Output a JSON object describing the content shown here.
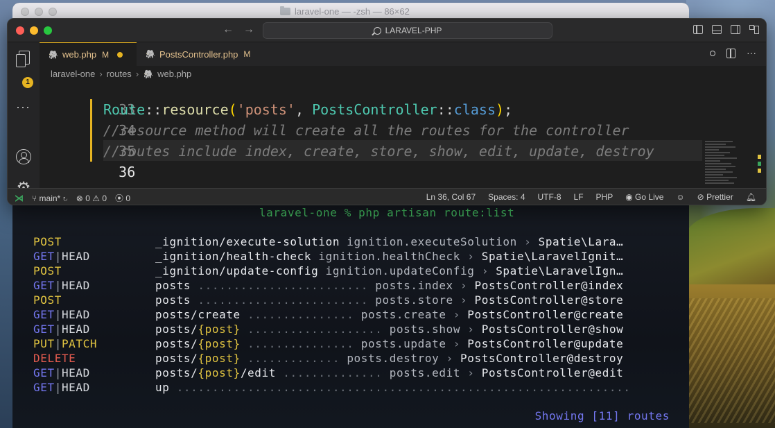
{
  "terminal": {
    "title": "laravel-one — -zsh — 86×62",
    "prompt": "laravel-one % php artisan route:list",
    "routes": [
      {
        "m1": "POST",
        "m2": "",
        "uri": "_ignition/execute-solution",
        "param": "",
        "uri_rest": "",
        "dots": "",
        "name": "ignition.executeSolution",
        "action": "Spatie\\Lara…",
        "m1_class": "m-post"
      },
      {
        "m1": "GET",
        "m2": "HEAD",
        "uri": "_ignition/health-check",
        "param": "",
        "uri_rest": "",
        "dots": "",
        "name": "ignition.healthCheck",
        "action": "Spatie\\LaravelIgnit…",
        "m1_class": "m-get"
      },
      {
        "m1": "POST",
        "m2": "",
        "uri": "_ignition/update-config",
        "param": "",
        "uri_rest": "",
        "dots": "",
        "name": "ignition.updateConfig",
        "action": "Spatie\\LaravelIgn…",
        "m1_class": "m-post"
      },
      {
        "m1": "GET",
        "m2": "HEAD",
        "uri": "posts",
        "param": "",
        "uri_rest": "",
        "dots": "........................",
        "name": "posts.index",
        "action": "PostsController@index",
        "m1_class": "m-get"
      },
      {
        "m1": "POST",
        "m2": "",
        "uri": "posts",
        "param": "",
        "uri_rest": "",
        "dots": "........................",
        "name": "posts.store",
        "action": "PostsController@store",
        "m1_class": "m-post"
      },
      {
        "m1": "GET",
        "m2": "HEAD",
        "uri": "posts/create",
        "param": "",
        "uri_rest": "",
        "dots": "...............",
        "name": "posts.create",
        "action": "PostsController@create",
        "m1_class": "m-get"
      },
      {
        "m1": "GET",
        "m2": "HEAD",
        "uri": "posts/",
        "param": "{post}",
        "uri_rest": "",
        "dots": "...................",
        "name": "posts.show",
        "action": "PostsController@show",
        "m1_class": "m-get"
      },
      {
        "m1": "PUT",
        "m2": "PATCH",
        "uri": "posts/",
        "param": "{post}",
        "uri_rest": "",
        "dots": "...............",
        "name": "posts.update",
        "action": "PostsController@update",
        "m1_class": "m-put"
      },
      {
        "m1": "DELETE",
        "m2": "",
        "uri": "posts/",
        "param": "{post}",
        "uri_rest": "",
        "dots": ".............",
        "name": "posts.destroy",
        "action": "PostsController@destroy",
        "m1_class": "m-delete"
      },
      {
        "m1": "GET",
        "m2": "HEAD",
        "uri": "posts/",
        "param": "{post}",
        "uri_rest": "/edit",
        "dots": "..............",
        "name": "posts.edit",
        "action": "PostsController@edit",
        "m1_class": "m-get"
      },
      {
        "m1": "GET",
        "m2": "HEAD",
        "uri": "up",
        "param": "",
        "uri_rest": "",
        "dots": "................................................................",
        "name": "",
        "action": "",
        "m1_class": "m-get"
      }
    ],
    "summary": "Showing [11] routes"
  },
  "vscode": {
    "search_label": "LARAVEL-PHP",
    "activity_badge": "1",
    "tabs": [
      {
        "name": "web.php",
        "status": "M"
      },
      {
        "name": "PostsController.php",
        "status": "M"
      }
    ],
    "breadcrumb": [
      "laravel-one",
      "routes",
      "web.php"
    ],
    "lines": [
      {
        "number": "33"
      },
      {
        "number": "34"
      },
      {
        "number": "35",
        "comment": "//resource method will create all the routes for the controller"
      },
      {
        "number": "36",
        "comment": "//routes include index, create, store, show, edit, update, destroy"
      }
    ],
    "code_34": {
      "cls": "Route",
      "op": "::",
      "fn": "resource",
      "str": "'posts'",
      "cls2": "PostsController",
      "kw": "class"
    },
    "status_bar": {
      "branch": "main*",
      "errors": "0",
      "warnings": "0",
      "ports": "0",
      "position": "Ln 36, Col 67",
      "spaces": "Spaces: 4",
      "encoding": "UTF-8",
      "eol": "LF",
      "language": "PHP",
      "go_live": "Go Live",
      "prettier": "Prettier"
    }
  },
  "colors": {
    "accent": "#e6b422",
    "post": "#e1c441",
    "get": "#7477f0",
    "delete": "#e35b4f",
    "prompt": "#45c063"
  },
  "icons": [
    "search-icon",
    "files-icon",
    "account-icon",
    "gear-icon",
    "branch-icon",
    "sync-icon",
    "error-icon",
    "warning-icon",
    "broadcast-icon",
    "copilot-icon",
    "prettier-icon",
    "bell-icon"
  ]
}
